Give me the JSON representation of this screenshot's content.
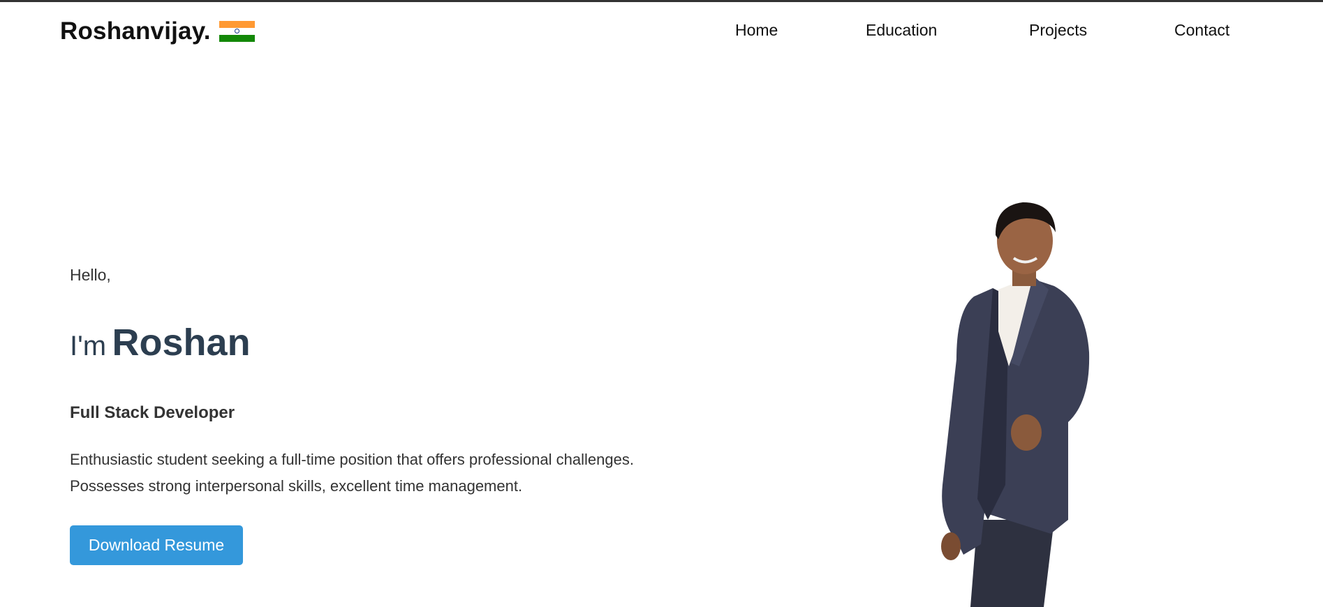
{
  "header": {
    "logo_text": "Roshanvijay.",
    "flag_icon": "india-flag-icon",
    "flag_colors": {
      "saffron": "#ff9933",
      "white": "#ffffff",
      "green": "#138808",
      "chakra": "#1a3a8a"
    }
  },
  "nav": {
    "items": [
      {
        "label": "Home"
      },
      {
        "label": "Education"
      },
      {
        "label": "Projects"
      },
      {
        "label": "Contact"
      }
    ]
  },
  "hero": {
    "greeting": "Hello,",
    "intro_prefix": "I'm",
    "name": "Roshan",
    "role": "Full Stack Developer",
    "description_lines": [
      "Enthusiastic student seeking a full-time position that offers professional challenges.",
      "Possesses strong interpersonal skills, excellent time management."
    ],
    "button_label": "Download Resume",
    "accent_color": "#3498db",
    "name_color": "#2c3e50"
  },
  "portrait": {
    "icon": "profile-photo"
  }
}
